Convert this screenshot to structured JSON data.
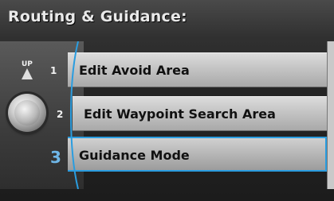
{
  "title": "Routing & Guidance:",
  "knob": {
    "up_label": "UP"
  },
  "menu": {
    "items": [
      {
        "number": "1",
        "label": "Edit Avoid Area"
      },
      {
        "number": "2",
        "label": "Edit Waypoint Search Area"
      },
      {
        "number": "3",
        "label": "Guidance Mode",
        "selected": true
      }
    ]
  },
  "colors": {
    "selection_border": "#2a9de0",
    "selected_number": "#6fb7e8"
  },
  "icons": [
    "up-arrow-icon",
    "selector-knob-icon"
  ]
}
